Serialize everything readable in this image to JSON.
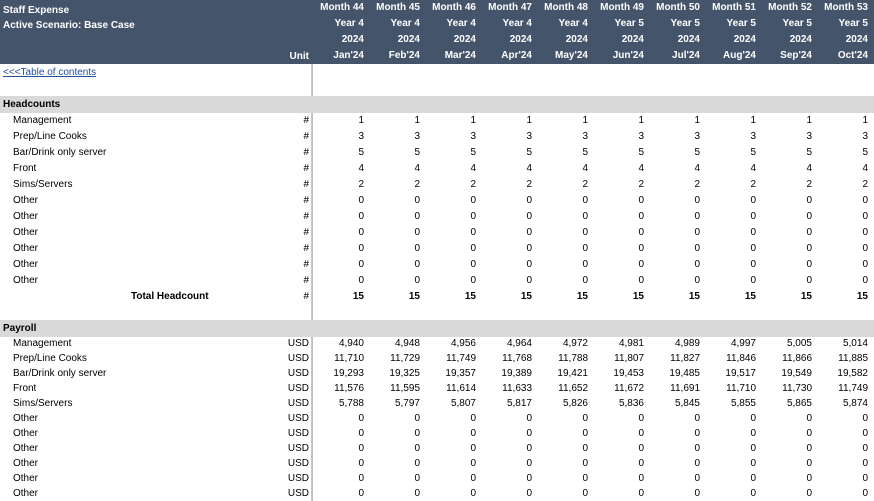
{
  "header": {
    "title": "Staff Expense",
    "scenario": "Active Scenario: Base Case",
    "unit_label": "Unit",
    "months": [
      "Month 44",
      "Month 45",
      "Month 46",
      "Month 47",
      "Month 48",
      "Month 49",
      "Month 50",
      "Month 51",
      "Month 52",
      "Month 53"
    ],
    "years": [
      "Year 4",
      "Year 4",
      "Year 4",
      "Year 4",
      "Year 4",
      "Year 5",
      "Year 5",
      "Year 5",
      "Year 5",
      "Year 5"
    ],
    "calendar_years": [
      "2024",
      "2024",
      "2024",
      "2024",
      "2024",
      "2024",
      "2024",
      "2024",
      "2024",
      "2024"
    ],
    "periods": [
      "Jan'24",
      "Feb'24",
      "Mar'24",
      "Apr'24",
      "May'24",
      "Jun'24",
      "Jul'24",
      "Aug'24",
      "Sep'24",
      "Oct'24"
    ]
  },
  "toc_link": "<<<Table of contents",
  "headcounts": {
    "title": "Headcounts",
    "rows": [
      {
        "label": "Management",
        "unit": "#",
        "values": [
          "1",
          "1",
          "1",
          "1",
          "1",
          "1",
          "1",
          "1",
          "1",
          "1"
        ]
      },
      {
        "label": "Prep/Line Cooks",
        "unit": "#",
        "values": [
          "3",
          "3",
          "3",
          "3",
          "3",
          "3",
          "3",
          "3",
          "3",
          "3"
        ]
      },
      {
        "label": "Bar/Drink only server",
        "unit": "#",
        "values": [
          "5",
          "5",
          "5",
          "5",
          "5",
          "5",
          "5",
          "5",
          "5",
          "5"
        ]
      },
      {
        "label": "Front",
        "unit": "#",
        "values": [
          "4",
          "4",
          "4",
          "4",
          "4",
          "4",
          "4",
          "4",
          "4",
          "4"
        ]
      },
      {
        "label": "Sims/Servers",
        "unit": "#",
        "values": [
          "2",
          "2",
          "2",
          "2",
          "2",
          "2",
          "2",
          "2",
          "2",
          "2"
        ]
      },
      {
        "label": "Other",
        "unit": "#",
        "values": [
          "0",
          "0",
          "0",
          "0",
          "0",
          "0",
          "0",
          "0",
          "0",
          "0"
        ]
      },
      {
        "label": "Other",
        "unit": "#",
        "values": [
          "0",
          "0",
          "0",
          "0",
          "0",
          "0",
          "0",
          "0",
          "0",
          "0"
        ]
      },
      {
        "label": "Other",
        "unit": "#",
        "values": [
          "0",
          "0",
          "0",
          "0",
          "0",
          "0",
          "0",
          "0",
          "0",
          "0"
        ]
      },
      {
        "label": "Other",
        "unit": "#",
        "values": [
          "0",
          "0",
          "0",
          "0",
          "0",
          "0",
          "0",
          "0",
          "0",
          "0"
        ]
      },
      {
        "label": "Other",
        "unit": "#",
        "values": [
          "0",
          "0",
          "0",
          "0",
          "0",
          "0",
          "0",
          "0",
          "0",
          "0"
        ]
      },
      {
        "label": "Other",
        "unit": "#",
        "values": [
          "0",
          "0",
          "0",
          "0",
          "0",
          "0",
          "0",
          "0",
          "0",
          "0"
        ]
      }
    ],
    "total": {
      "label": "Total Headcount",
      "unit": "#",
      "values": [
        "15",
        "15",
        "15",
        "15",
        "15",
        "15",
        "15",
        "15",
        "15",
        "15"
      ]
    }
  },
  "payroll": {
    "title": "Payroll",
    "rows": [
      {
        "label": "Management",
        "unit": "USD",
        "values": [
          "4,940",
          "4,948",
          "4,956",
          "4,964",
          "4,972",
          "4,981",
          "4,989",
          "4,997",
          "5,005",
          "5,014"
        ]
      },
      {
        "label": "Prep/Line Cooks",
        "unit": "USD",
        "values": [
          "11,710",
          "11,729",
          "11,749",
          "11,768",
          "11,788",
          "11,807",
          "11,827",
          "11,846",
          "11,866",
          "11,885"
        ]
      },
      {
        "label": "Bar/Drink only server",
        "unit": "USD",
        "values": [
          "19,293",
          "19,325",
          "19,357",
          "19,389",
          "19,421",
          "19,453",
          "19,485",
          "19,517",
          "19,549",
          "19,582"
        ]
      },
      {
        "label": "Front",
        "unit": "USD",
        "values": [
          "11,576",
          "11,595",
          "11,614",
          "11,633",
          "11,652",
          "11,672",
          "11,691",
          "11,710",
          "11,730",
          "11,749"
        ]
      },
      {
        "label": "Sims/Servers",
        "unit": "USD",
        "values": [
          "5,788",
          "5,797",
          "5,807",
          "5,817",
          "5,826",
          "5,836",
          "5,845",
          "5,855",
          "5,865",
          "5,874"
        ]
      },
      {
        "label": "Other",
        "unit": "USD",
        "values": [
          "0",
          "0",
          "0",
          "0",
          "0",
          "0",
          "0",
          "0",
          "0",
          "0"
        ]
      },
      {
        "label": "Other",
        "unit": "USD",
        "values": [
          "0",
          "0",
          "0",
          "0",
          "0",
          "0",
          "0",
          "0",
          "0",
          "0"
        ]
      },
      {
        "label": "Other",
        "unit": "USD",
        "values": [
          "0",
          "0",
          "0",
          "0",
          "0",
          "0",
          "0",
          "0",
          "0",
          "0"
        ]
      },
      {
        "label": "Other",
        "unit": "USD",
        "values": [
          "0",
          "0",
          "0",
          "0",
          "0",
          "0",
          "0",
          "0",
          "0",
          "0"
        ]
      },
      {
        "label": "Other",
        "unit": "USD",
        "values": [
          "0",
          "0",
          "0",
          "0",
          "0",
          "0",
          "0",
          "0",
          "0",
          "0"
        ]
      },
      {
        "label": "Other",
        "unit": "USD",
        "values": [
          "0",
          "0",
          "0",
          "0",
          "0",
          "0",
          "0",
          "0",
          "0",
          "0"
        ]
      }
    ]
  },
  "colors": {
    "header_bg": "#44546a",
    "section_bg": "#d9d9d9",
    "link": "#1f4e9c"
  }
}
